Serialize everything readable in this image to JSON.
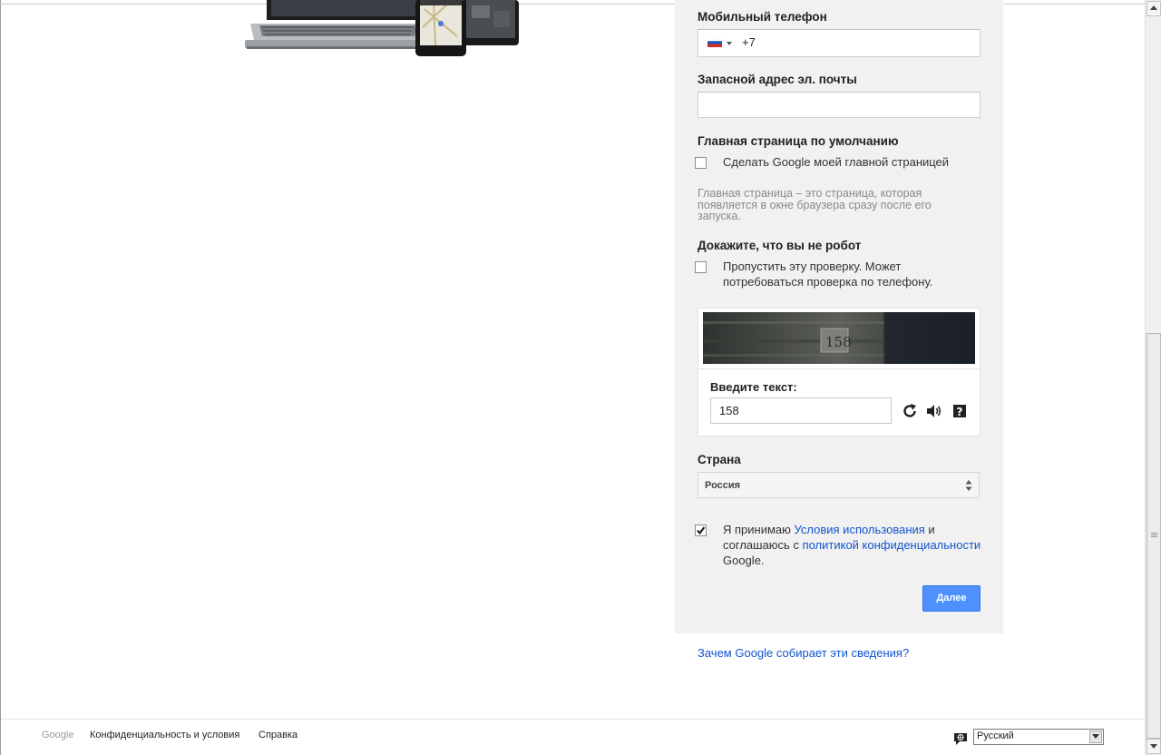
{
  "form": {
    "mobile_label": "Мобильный телефон",
    "phone_code": "+7",
    "backup_email_label": "Запасной адрес эл. почты",
    "backup_email_value": "",
    "homepage_label": "Главная страница по умолчанию",
    "homepage_checkbox_text": "Сделать Google моей главной страницей",
    "homepage_checked": false,
    "homepage_hint": "Главная страница – это страница, которая появляется в окне браузера сразу после его запуска.",
    "robot_label": "Докажите, что вы не робот",
    "robot_checkbox_text": "Пропустить эту проверку. Может потребоваться проверка по телефону.",
    "robot_checked": false,
    "captcha_label": "Введите текст:",
    "captcha_value": "158",
    "captcha_image_text": "158",
    "country_label": "Страна",
    "country_value": "Россия",
    "terms_checked": true,
    "terms_text_1": "Я принимаю ",
    "terms_link_1": "Условия использования",
    "terms_text_2": " и соглашаюсь с ",
    "terms_link_2": "политикой конфиденциальности",
    "terms_text_3": " Google.",
    "next_button": "Далее"
  },
  "why_link": "Зачем Google собирает эти сведения?",
  "footer": {
    "google": "Google",
    "privacy": "Конфиденциальность и условия",
    "help": "Справка",
    "language": "Русский"
  },
  "colors": {
    "panel_bg": "#f1f1f1",
    "link": "#1155cc",
    "primary_button": "#4d90fe"
  },
  "icons": [
    "russia-flag-icon",
    "refresh-icon",
    "audio-icon",
    "help-icon",
    "language-chat-icon",
    "dropdown-arrow-icon"
  ]
}
